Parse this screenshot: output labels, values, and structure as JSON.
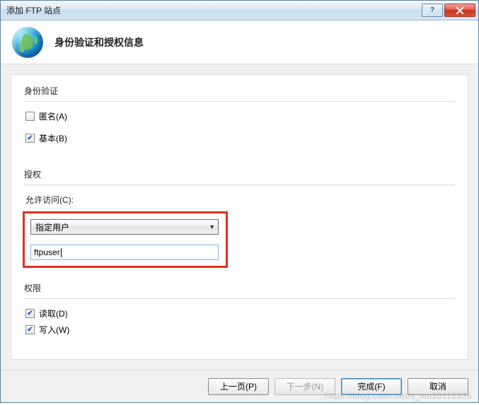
{
  "window": {
    "title": "添加 FTP 站点"
  },
  "header": {
    "title": "身份验证和授权信息"
  },
  "auth": {
    "group_label": "身份验证",
    "anonymous": {
      "label": "匿名(A)",
      "checked": false
    },
    "basic": {
      "label": "基本(B)",
      "checked": true
    }
  },
  "authorization": {
    "group_label": "授权",
    "allow_access_label": "允许访问(C):",
    "dropdown_selected": "指定用户",
    "user_input": "ftpuser"
  },
  "permissions": {
    "group_label": "权限",
    "read": {
      "label": "读取(D)",
      "checked": true
    },
    "write": {
      "label": "写入(W)",
      "checked": true
    }
  },
  "footer": {
    "prev": "上一页(P)",
    "next": "下一步(N)",
    "finish": "完成(F)",
    "cancel": "取消"
  },
  "watermark": "https://blog.csdn.net/s_xia20112335"
}
